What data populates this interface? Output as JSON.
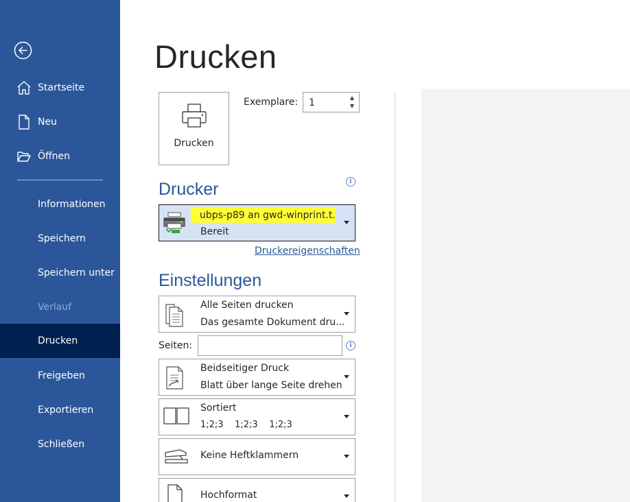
{
  "sidebar": {
    "items": [
      {
        "label": "Startseite",
        "icon": "home-icon"
      },
      {
        "label": "Neu",
        "icon": "new-document-icon"
      },
      {
        "label": "Öffnen",
        "icon": "folder-open-icon"
      },
      {
        "label": "Informationen"
      },
      {
        "label": "Speichern"
      },
      {
        "label": "Speichern unter"
      },
      {
        "label": "Verlauf",
        "disabled": true
      },
      {
        "label": "Drucken",
        "active": true
      },
      {
        "label": "Freigeben"
      },
      {
        "label": "Exportieren"
      },
      {
        "label": "Schließen"
      }
    ]
  },
  "main": {
    "title": "Drucken",
    "print_button": "Drucken",
    "copies": {
      "label": "Exemplare:",
      "value": "1"
    },
    "printer": {
      "heading": "Drucker",
      "name": "ubps-p89 an gwd-winprint.t...",
      "status": "Bereit",
      "properties_link": "Druckereigenschaften"
    },
    "settings": {
      "heading": "Einstellungen",
      "pages_label": "Seiten:",
      "items": [
        {
          "line1": "Alle Seiten drucken",
          "line2": "Das gesamte Dokument dru..."
        },
        {
          "line1": "Beidseitiger Druck",
          "line2": "Blatt über lange Seite drehen"
        },
        {
          "line1": "Sortiert",
          "line2": "1;2;3    1;2;3    1;2;3"
        },
        {
          "line1": "Keine Heftklammern"
        },
        {
          "line1": "Hochformat"
        }
      ]
    }
  },
  "colors": {
    "sidebar_bg": "#2b579a",
    "sidebar_active": "#002050",
    "accent": "#2b579a",
    "highlight": "#ffff33",
    "printer_select_bg": "#d6e3f5"
  }
}
